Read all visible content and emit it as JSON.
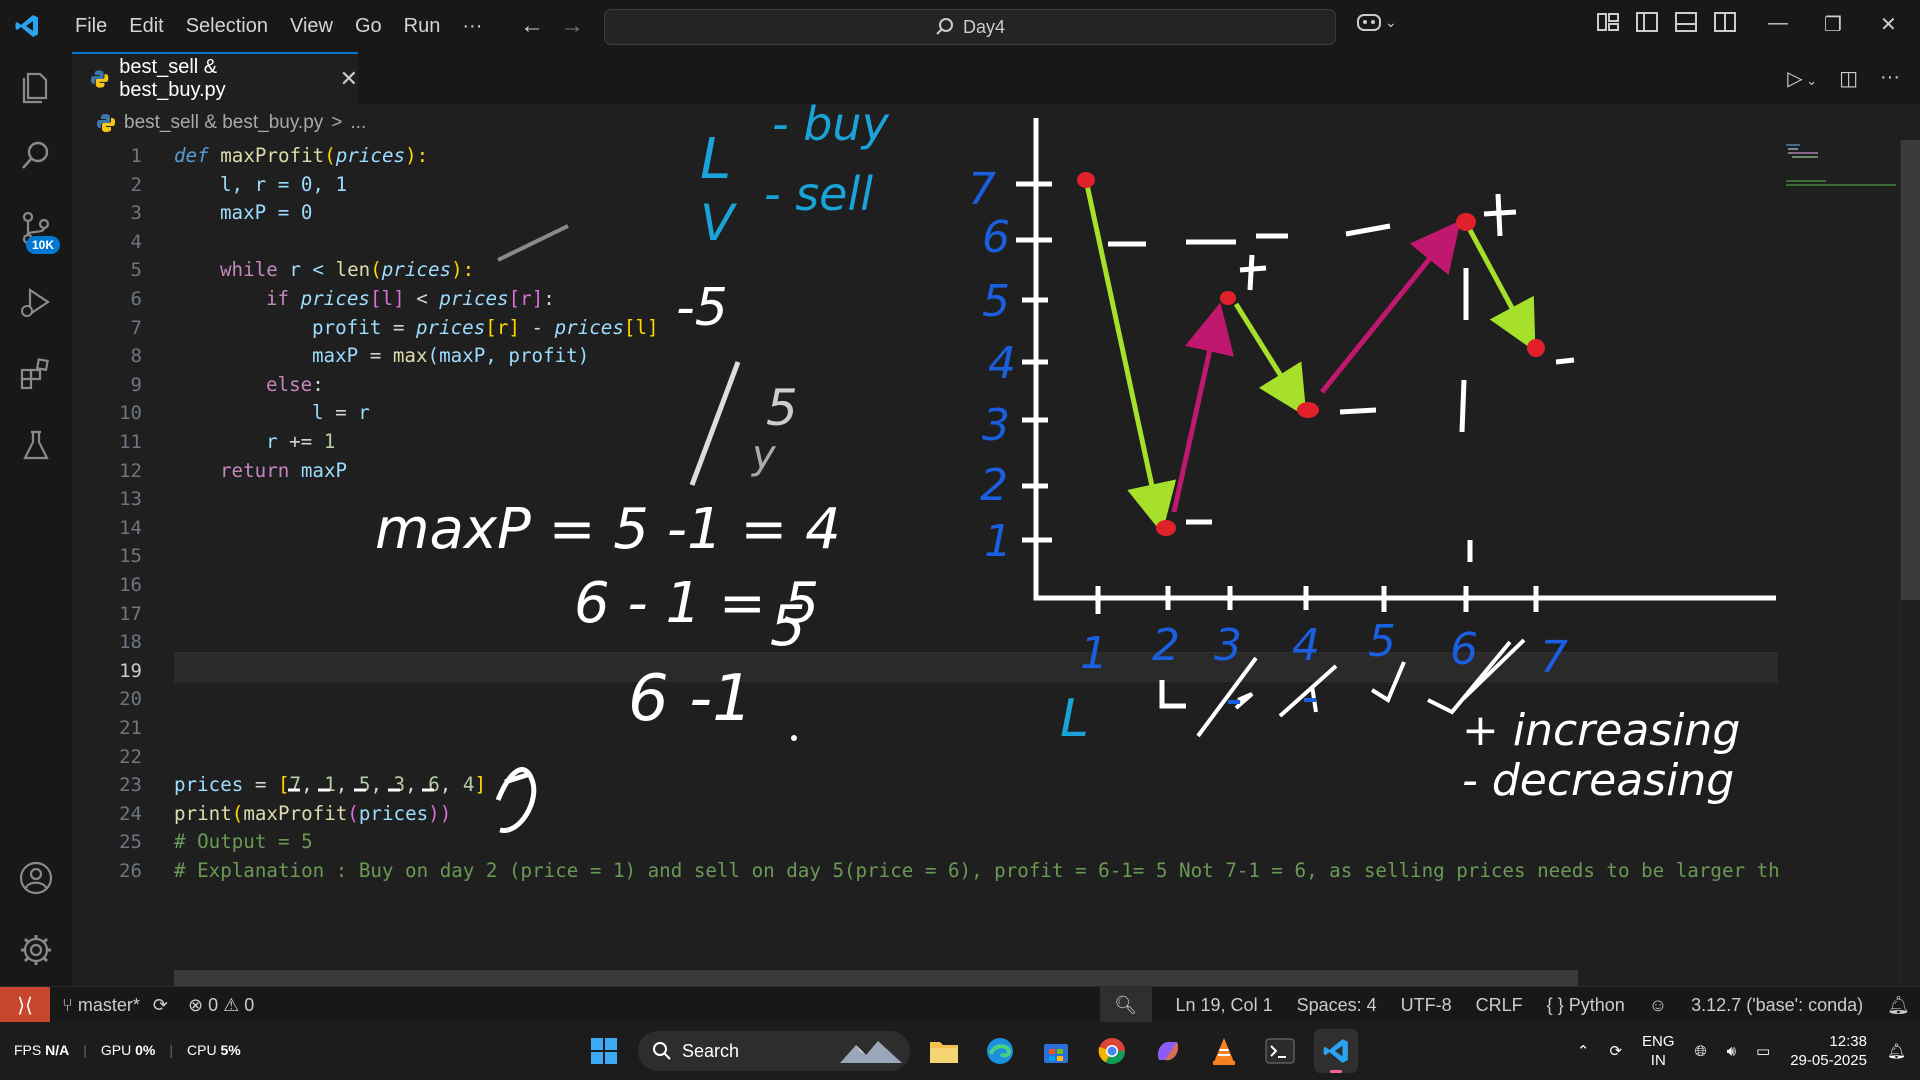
{
  "window": {
    "menu": [
      "File",
      "Edit",
      "Selection",
      "View",
      "Go",
      "Run",
      "···"
    ],
    "search_label": "Day4"
  },
  "activity": {
    "source_control_badge": "10K"
  },
  "tab": {
    "label": "best_sell & best_buy.py",
    "close": "✕"
  },
  "breadcrumb": {
    "file": "best_sell & best_buy.py",
    "sep": ">",
    "more": "..."
  },
  "editor": {
    "line_numbers": [
      "1",
      "2",
      "3",
      "4",
      "5",
      "6",
      "7",
      "8",
      "9",
      "10",
      "11",
      "12",
      "13",
      "14",
      "15",
      "16",
      "17",
      "18",
      "19",
      "20",
      "21",
      "22",
      "23",
      "24",
      "25",
      "26"
    ],
    "active_line": 19,
    "code": {
      "l1": [
        "def",
        "maxProfit",
        "(",
        "prices",
        "):"
      ],
      "l2": "l, r = 0, 1",
      "l3": "maxP = 0",
      "l5": [
        "while",
        " r < ",
        "len",
        "(",
        "prices",
        "):"
      ],
      "l6": [
        "if",
        " prices",
        "[l]",
        " < ",
        "prices",
        "[r]",
        ":"
      ],
      "l7": [
        "profit",
        " = ",
        "prices",
        "[r]",
        " - ",
        "prices",
        "[l]"
      ],
      "l8": [
        "maxP",
        " = ",
        "max",
        "(maxP, profit)"
      ],
      "l9": [
        "else",
        ":"
      ],
      "l10": [
        "l",
        " = ",
        "r"
      ],
      "l11": [
        "r",
        " += ",
        "1"
      ],
      "l12": [
        "return",
        " maxP"
      ],
      "l23": [
        "prices",
        " = ",
        "[",
        "7",
        ", ",
        "1",
        ", ",
        "5",
        ", ",
        "3",
        ", ",
        "6",
        ", ",
        "4",
        "]"
      ],
      "l24": [
        "print",
        "(",
        "maxProfit",
        "(",
        "prices",
        "))"
      ],
      "l25": "# Output = 5",
      "l26": "# Explanation : Buy on day 2 (price = 1) and sell on day 5(price = 6), profit = 6-1= 5 Not 7-1 = 6, as selling prices needs to be larger th"
    }
  },
  "ink": {
    "top_notes": [
      "L",
      "- buy",
      "V",
      "- sell"
    ],
    "minus5": "-5",
    "five_a": "5",
    "maxp_line": "maxP = 5 -1 = 4",
    "y_mark": "y",
    "eq1": "6 - 1 = 5",
    "eq2": "6 - 1 = 5",
    "small_6": "6 -1",
    "five_b": "5",
    "y_ticks": [
      "7",
      "6",
      "5",
      "4",
      "3",
      "2",
      "1"
    ],
    "x_ticks": [
      "1",
      "2",
      "3",
      "4",
      "5",
      "6",
      "7"
    ],
    "legend_plus": "+ increasing",
    "legend_minus": "- decreasing",
    "l_mark": "L"
  },
  "status": {
    "branch": "master*",
    "errors": "0",
    "warnings": "0",
    "position": "Ln 19, Col 1",
    "spaces": "Spaces: 4",
    "encoding": "UTF-8",
    "eol": "CRLF",
    "language": "Python",
    "interpreter": "3.12.7 ('base': conda)"
  },
  "taskbar": {
    "fps_label": "FPS",
    "fps_val": "N/A",
    "gpu_label": "GPU",
    "gpu_val": "0%",
    "cpu_label": "CPU",
    "cpu_val": "5%",
    "search": "Search",
    "lang_1": "ENG",
    "lang_2": "IN",
    "time": "12:38",
    "date": "29-05-2025"
  },
  "colors": {
    "accent": "#0078d4",
    "ink_white": "#ffffff",
    "ink_blue": "#1a5fe0",
    "ink_cyan": "#19a3d9",
    "ink_green": "#a6e02a",
    "ink_magenta": "#c0186e",
    "ink_red": "#e0202a"
  }
}
